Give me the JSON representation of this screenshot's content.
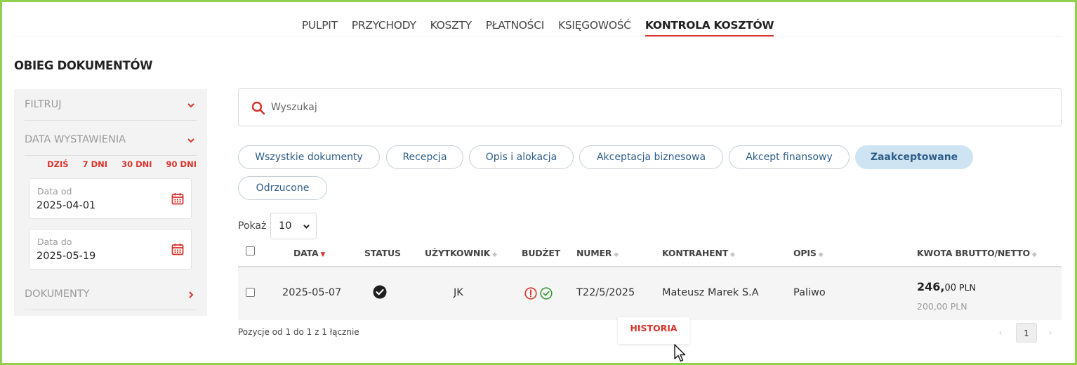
{
  "top_nav": {
    "items": [
      {
        "label": "PULPIT"
      },
      {
        "label": "PRZYCHODY"
      },
      {
        "label": "KOSZTY"
      },
      {
        "label": "PŁATNOŚCI"
      },
      {
        "label": "KSIĘGOWOŚĆ"
      },
      {
        "label": "KONTROLA KOSZTÓW",
        "active": true
      }
    ]
  },
  "page_title": "OBIEG DOKUMENTÓW",
  "sidebar": {
    "filter_label": "FILTRUJ",
    "date_section_label": "DATA WYSTAWIENIA",
    "quick_dates": [
      "DZIŚ",
      "7 DNI",
      "30 DNI",
      "90 DNI"
    ],
    "date_from": {
      "label": "Data od",
      "value": "2025-04-01"
    },
    "date_to": {
      "label": "Data do",
      "value": "2025-05-19"
    },
    "documents_label": "DOKUMENTY"
  },
  "search": {
    "placeholder": "Wyszukaj",
    "value": ""
  },
  "status_filters": [
    {
      "label": "Wszystkie dokumenty"
    },
    {
      "label": "Recepcja"
    },
    {
      "label": "Opis i alokacja"
    },
    {
      "label": "Akceptacja biznesowa"
    },
    {
      "label": "Akcept finansowy"
    },
    {
      "label": "Zaakceptowane",
      "active": true
    },
    {
      "label": "Odrzucone"
    }
  ],
  "page_size": {
    "label": "Pokaż",
    "value": "10"
  },
  "table": {
    "columns": {
      "date": "DATA",
      "status": "STATUS",
      "user": "UŻYTKOWNIK",
      "budget": "BUDŻET",
      "number": "NUMER",
      "contractor": "KONTRAHENT",
      "description": "OPIS",
      "amount": "KWOTA BRUTTO/NETTO"
    },
    "rows": [
      {
        "date": "2025-05-07",
        "user": "JK",
        "number": "T22/5/2025",
        "contractor": "Mateusz Marek S.A",
        "description": "Paliwo",
        "gross_main": "246,",
        "gross_cents": "00",
        "currency": "PLN",
        "net": "200,00 PLN"
      }
    ]
  },
  "footer": {
    "positions_info": "Pozycje od 1 do 1 z 1 łącznie",
    "current_page": "1",
    "prev": "‹",
    "next": "›"
  },
  "tooltip": "HISTORIA",
  "colors": {
    "accent_red": "#d9342b",
    "pill_text": "#2e5d88",
    "pill_active_bg": "#cfe4f2",
    "frame_green": "#8fd14f"
  }
}
